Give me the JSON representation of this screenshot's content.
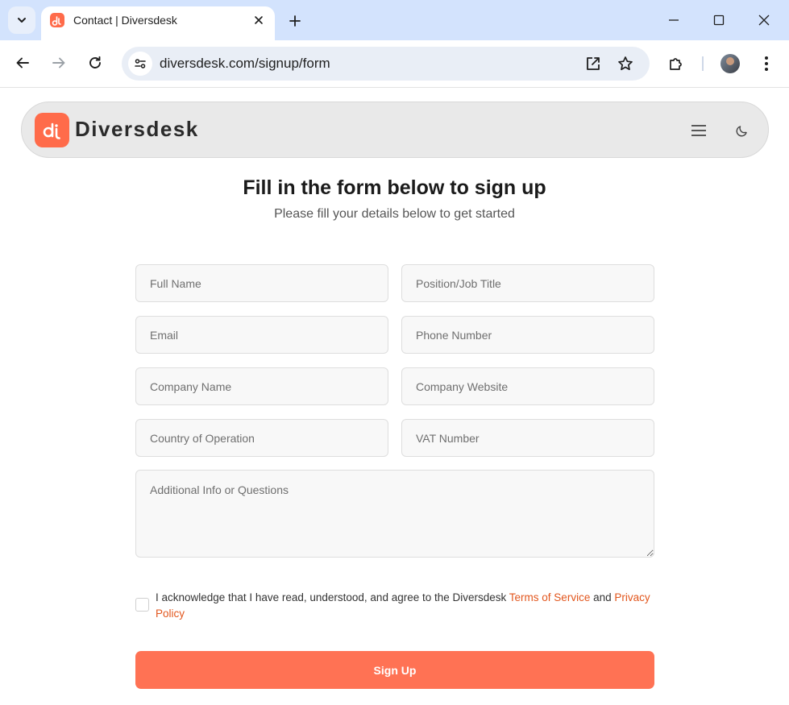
{
  "browser": {
    "tab_title": "Contact | Diversdesk",
    "url": "diversdesk.com/signup/form"
  },
  "header": {
    "logo_text": "Diversdesk"
  },
  "main": {
    "title": "Fill in the form below to sign up",
    "subtitle": "Please fill your details below to get started"
  },
  "form": {
    "full_name_placeholder": "Full Name",
    "position_placeholder": "Position/Job Title",
    "email_placeholder": "Email",
    "phone_placeholder": "Phone Number",
    "company_name_placeholder": "Company Name",
    "company_website_placeholder": "Company Website",
    "country_placeholder": "Country of Operation",
    "vat_placeholder": "VAT Number",
    "additional_info_placeholder": "Additional Info or Questions",
    "consent_prefix": "I acknowledge that I have read, understood, and agree to the Diversdesk ",
    "terms_link": "Terms of Service",
    "consent_and": " and ",
    "privacy_link": "Privacy Policy",
    "submit_label": "Sign Up"
  },
  "colors": {
    "accent": "#ff7254",
    "link": "#e2561d",
    "chrome_bg": "#d3e3fd"
  }
}
